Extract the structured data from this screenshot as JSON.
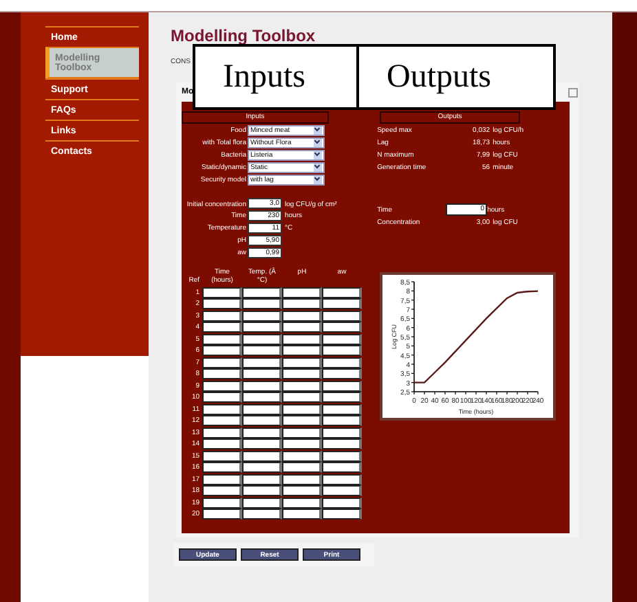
{
  "sidebar": {
    "items": [
      {
        "label": "Home",
        "selected": false
      },
      {
        "label": "Modelling Toolbox",
        "selected": true
      },
      {
        "label": "Support",
        "selected": false
      },
      {
        "label": "FAQs",
        "selected": false
      },
      {
        "label": "Links",
        "selected": false
      },
      {
        "label": "Contacts",
        "selected": false
      }
    ]
  },
  "page": {
    "title": "Modelling Toolbox",
    "intro": "CONS",
    "panel_tab": "Mo"
  },
  "overlay_labels": [
    "Inputs",
    "Outputs"
  ],
  "inputs": {
    "title": "Inputs",
    "selects": [
      {
        "label": "Food",
        "value": "Minced meat"
      },
      {
        "label": "with Total flora",
        "value": "Without Flora"
      },
      {
        "label": "Bacteria",
        "value": "Listeria"
      },
      {
        "label": "Static/dynamic",
        "value": "Static"
      },
      {
        "label": "Security model",
        "value": "with lag"
      }
    ],
    "fields": [
      {
        "label": "Initial concentration",
        "value": "3,0",
        "unit": "log CFU/g of cm²"
      },
      {
        "label": "Time",
        "value": "230",
        "unit": "hours"
      },
      {
        "label": "Temperature",
        "value": "11",
        "unit": "°C"
      },
      {
        "label": "pH",
        "value": "5,90"
      },
      {
        "label": "aw",
        "value": "0,99"
      }
    ]
  },
  "outputs": {
    "title": "Outputs",
    "results": [
      {
        "label": "Speed max",
        "value": "0,032",
        "unit": "log CFU/h"
      },
      {
        "label": "Lag",
        "value": "18,73",
        "unit": "hours"
      },
      {
        "label": "N maximum",
        "value": "7,99",
        "unit": "log CFU"
      },
      {
        "label": "Generation time",
        "value": "56",
        "unit": "minute"
      }
    ],
    "time_field": {
      "label": "Time",
      "value": "0",
      "unit": "hours"
    },
    "concentration": {
      "label": "Concentration",
      "value": "3,00",
      "unit": "log CFU"
    },
    "chart_data": {
      "type": "line",
      "xlabel": "Time (hours)",
      "ylabel": "Log CFU",
      "x": [
        0,
        20,
        40,
        60,
        80,
        100,
        120,
        140,
        160,
        180,
        200,
        220,
        240
      ],
      "series": [
        {
          "color": "#5a1a1a",
          "values": [
            3,
            3,
            3.55,
            4.1,
            4.7,
            5.3,
            5.9,
            6.5,
            7.05,
            7.6,
            7.9,
            7.97,
            7.99
          ]
        }
      ],
      "xlim": [
        0,
        240
      ],
      "ylim": [
        2.5,
        8.5
      ],
      "xticks": [
        0,
        20,
        40,
        60,
        80,
        100,
        120,
        140,
        160,
        180,
        200,
        220,
        240
      ],
      "yticks": [
        {
          "value": 2.5,
          "label": "2,5"
        },
        3,
        {
          "value": 3.5,
          "label": "3,5"
        },
        4,
        {
          "value": 4.5,
          "label": "4,5"
        },
        5,
        {
          "value": 5.5,
          "label": "5,5"
        },
        6,
        {
          "value": 6.5,
          "label": "6,5"
        },
        7,
        {
          "value": 7.5,
          "label": "7,5"
        },
        8,
        {
          "value": 8.5,
          "label": "8,5"
        }
      ]
    }
  },
  "table": {
    "columns": [
      "Ref",
      "Time (hours)",
      "Temp. (Â °C)",
      "pH",
      "aw"
    ],
    "rows": [
      "1",
      "2",
      "3",
      "4",
      "5",
      "6",
      "7",
      "8",
      "9",
      "10",
      "11",
      "12",
      "13",
      "14",
      "15",
      "16",
      "17",
      "18",
      "19",
      "20"
    ]
  },
  "buttons": [
    "Update",
    "Reset",
    "Print"
  ]
}
